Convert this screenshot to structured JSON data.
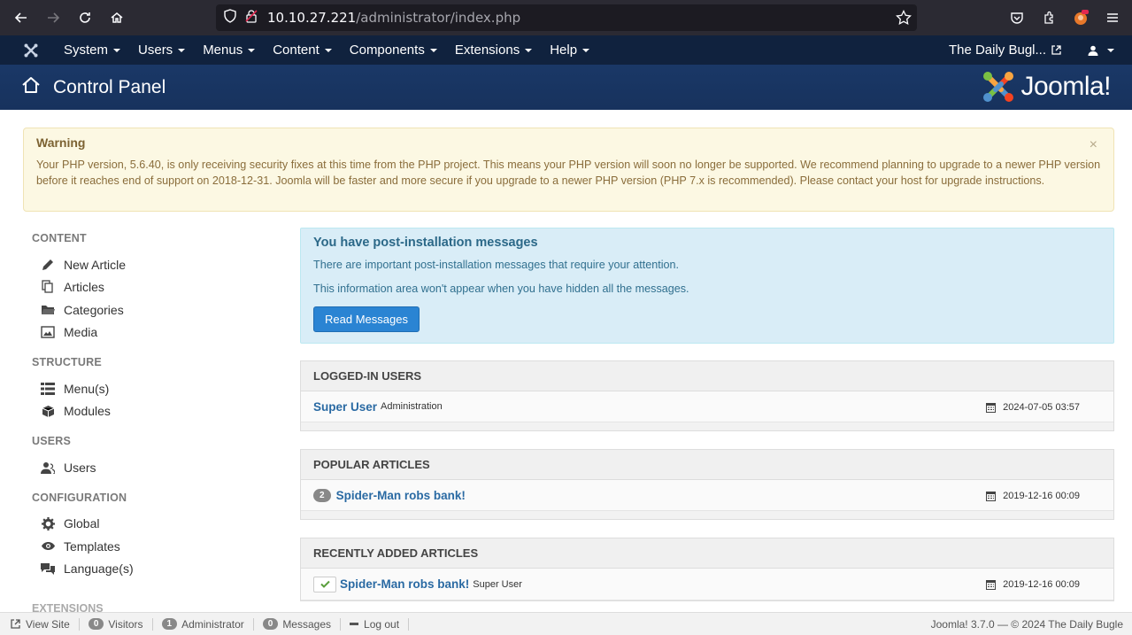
{
  "browser": {
    "url_host": "10.10.27.221",
    "url_path": "/administrator/index.php"
  },
  "topnav": {
    "menus": [
      {
        "label": "System"
      },
      {
        "label": "Users"
      },
      {
        "label": "Menus"
      },
      {
        "label": "Content"
      },
      {
        "label": "Components"
      },
      {
        "label": "Extensions"
      },
      {
        "label": "Help"
      }
    ],
    "site_name": "The Daily Bugl..."
  },
  "header": {
    "title": "Control Panel",
    "brand": "Joomla!"
  },
  "warning": {
    "title": "Warning",
    "text": "Your PHP version, 5.6.40, is only receiving security fixes at this time from the PHP project. This means your PHP version will soon no longer be supported. We recommend planning to upgrade to a newer PHP version before it reaches end of support on 2018-12-31. Joomla will be faster and more secure if you upgrade to a newer PHP version (PHP 7.x is recommended). Please contact your host for upgrade instructions.",
    "close": "×"
  },
  "sidebar": {
    "content_heading": "CONTENT",
    "content_items": [
      "New Article",
      "Articles",
      "Categories",
      "Media"
    ],
    "structure_heading": "STRUCTURE",
    "structure_items": [
      "Menu(s)",
      "Modules"
    ],
    "users_heading": "USERS",
    "users_items": [
      "Users"
    ],
    "config_heading": "CONFIGURATION",
    "config_items": [
      "Global",
      "Templates",
      "Language(s)"
    ],
    "extensions_heading": "EXTENSIONS"
  },
  "postinstall": {
    "title": "You have post-installation messages",
    "line1": "There are important post-installation messages that require your attention.",
    "line2": "This information area won't appear when you have hidden all the messages.",
    "button": "Read Messages"
  },
  "logged_in": {
    "heading": "LOGGED-IN USERS",
    "user": "Super User",
    "area": "Administration",
    "date": "2024-07-05 03:57"
  },
  "popular": {
    "heading": "POPULAR ARTICLES",
    "hits": "2",
    "title": "Spider-Man robs bank!",
    "date": "2019-12-16 00:09"
  },
  "recent": {
    "heading": "RECENTLY ADDED ARTICLES",
    "title": "Spider-Man robs bank!",
    "author": "Super User",
    "date": "2019-12-16 00:09"
  },
  "statusbar": {
    "view_site": "View Site",
    "visitors_count": "0",
    "visitors": "Visitors",
    "admin_count": "1",
    "admin": "Administrator",
    "messages_count": "0",
    "messages": "Messages",
    "logout": "Log out",
    "version": "Joomla! 3.7.0  —  © 2024 The Daily Bugle"
  }
}
